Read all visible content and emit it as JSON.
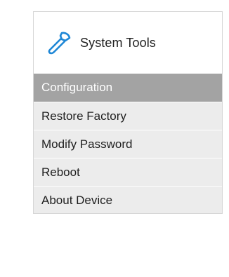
{
  "header": {
    "title": "System Tools",
    "icon": "wrench-icon",
    "icon_color": "#1e87d6"
  },
  "menu": {
    "items": [
      {
        "label": "Configuration",
        "active": true
      },
      {
        "label": "Restore Factory",
        "active": false
      },
      {
        "label": "Modify Password",
        "active": false
      },
      {
        "label": "Reboot",
        "active": false
      },
      {
        "label": "About Device",
        "active": false
      }
    ]
  },
  "colors": {
    "active_bg": "#a3a3a3",
    "item_bg": "#ececec",
    "accent": "#1e87d6"
  }
}
